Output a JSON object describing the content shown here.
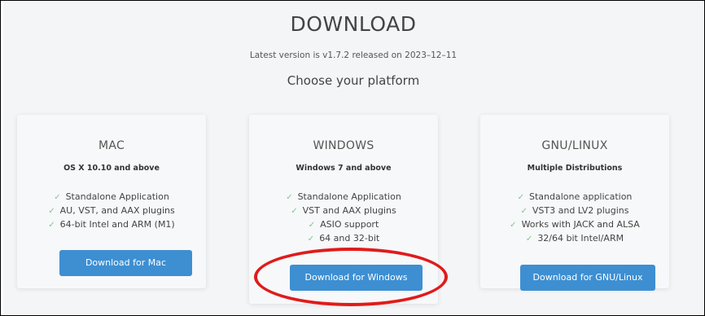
{
  "header": {
    "title": "DOWNLOAD",
    "subtitle": "Latest version is v1.7.2 released on 2023–12–11",
    "choose": "Choose your platform"
  },
  "platforms": [
    {
      "name": "MAC",
      "requirement": "OS X 10.10 and above",
      "features": [
        "Standalone Application",
        "AU, VST, and AAX plugins",
        "64-bit Intel and ARM (M1)"
      ],
      "button": "Download for Mac"
    },
    {
      "name": "WINDOWS",
      "requirement": "Windows 7 and above",
      "features": [
        "Standalone Application",
        "VST and AAX plugins",
        "ASIO support",
        "64 and 32-bit"
      ],
      "button": "Download for Windows"
    },
    {
      "name": "GNU/LINUX",
      "requirement": "Multiple Distributions",
      "features": [
        "Standalone application",
        "VST3 and LV2 plugins",
        "Works with JACK and ALSA",
        "32/64 bit Intel/ARM"
      ],
      "button": "Download for GNU/Linux"
    }
  ],
  "icons": {
    "check": "✓"
  },
  "colors": {
    "accent": "#3d8fd2",
    "check": "#7cc68a",
    "highlight": "#e01b1b",
    "background": "#f4f5f7"
  }
}
